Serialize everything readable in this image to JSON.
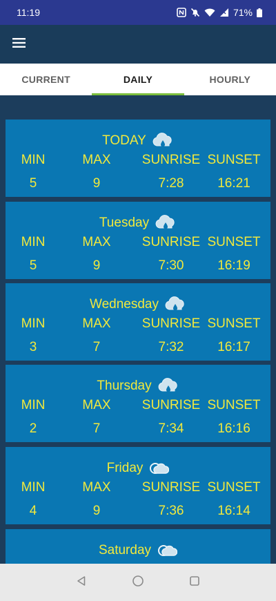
{
  "status": {
    "time": "11:19",
    "battery": "71%",
    "icons": [
      "nfc-icon",
      "mute-bell-icon",
      "wifi-icon",
      "signal-icon",
      "battery-icon"
    ]
  },
  "appbar": {
    "menu_icon": "hamburger-menu-icon"
  },
  "tabs": [
    {
      "label": "CURRENT",
      "active": false
    },
    {
      "label": "DAILY",
      "active": true
    },
    {
      "label": "HOURLY",
      "active": false
    }
  ],
  "columns": {
    "min": "MIN",
    "max": "MAX",
    "sunrise": "SUNRISE",
    "sunset": "SUNSET"
  },
  "days": [
    {
      "name": "TODAY",
      "icon": "rain-cloud-icon",
      "min": "5",
      "max": "9",
      "sunrise": "7:28",
      "sunset": "16:21"
    },
    {
      "name": "Tuesday",
      "icon": "rain-cloud-icon",
      "min": "5",
      "max": "9",
      "sunrise": "7:30",
      "sunset": "16:19"
    },
    {
      "name": "Wednesday",
      "icon": "rain-cloud-icon",
      "min": "3",
      "max": "7",
      "sunrise": "7:32",
      "sunset": "16:17"
    },
    {
      "name": "Thursday",
      "icon": "rain-cloud-icon",
      "min": "2",
      "max": "7",
      "sunrise": "7:34",
      "sunset": "16:16"
    },
    {
      "name": "Friday",
      "icon": "partly-cloudy-icon",
      "min": "4",
      "max": "9",
      "sunrise": "7:36",
      "sunset": "16:14"
    },
    {
      "name": "Saturday",
      "icon": "partly-cloudy-icon"
    }
  ],
  "colors": {
    "status_bar": "#2b3990",
    "app_bar": "#1a3c5a",
    "card": "#0a77b3",
    "text": "#f2e93c",
    "tab_indicator": "#7cbe3c"
  },
  "navbar": {
    "icons": [
      "back-icon",
      "home-icon",
      "recents-icon"
    ]
  }
}
